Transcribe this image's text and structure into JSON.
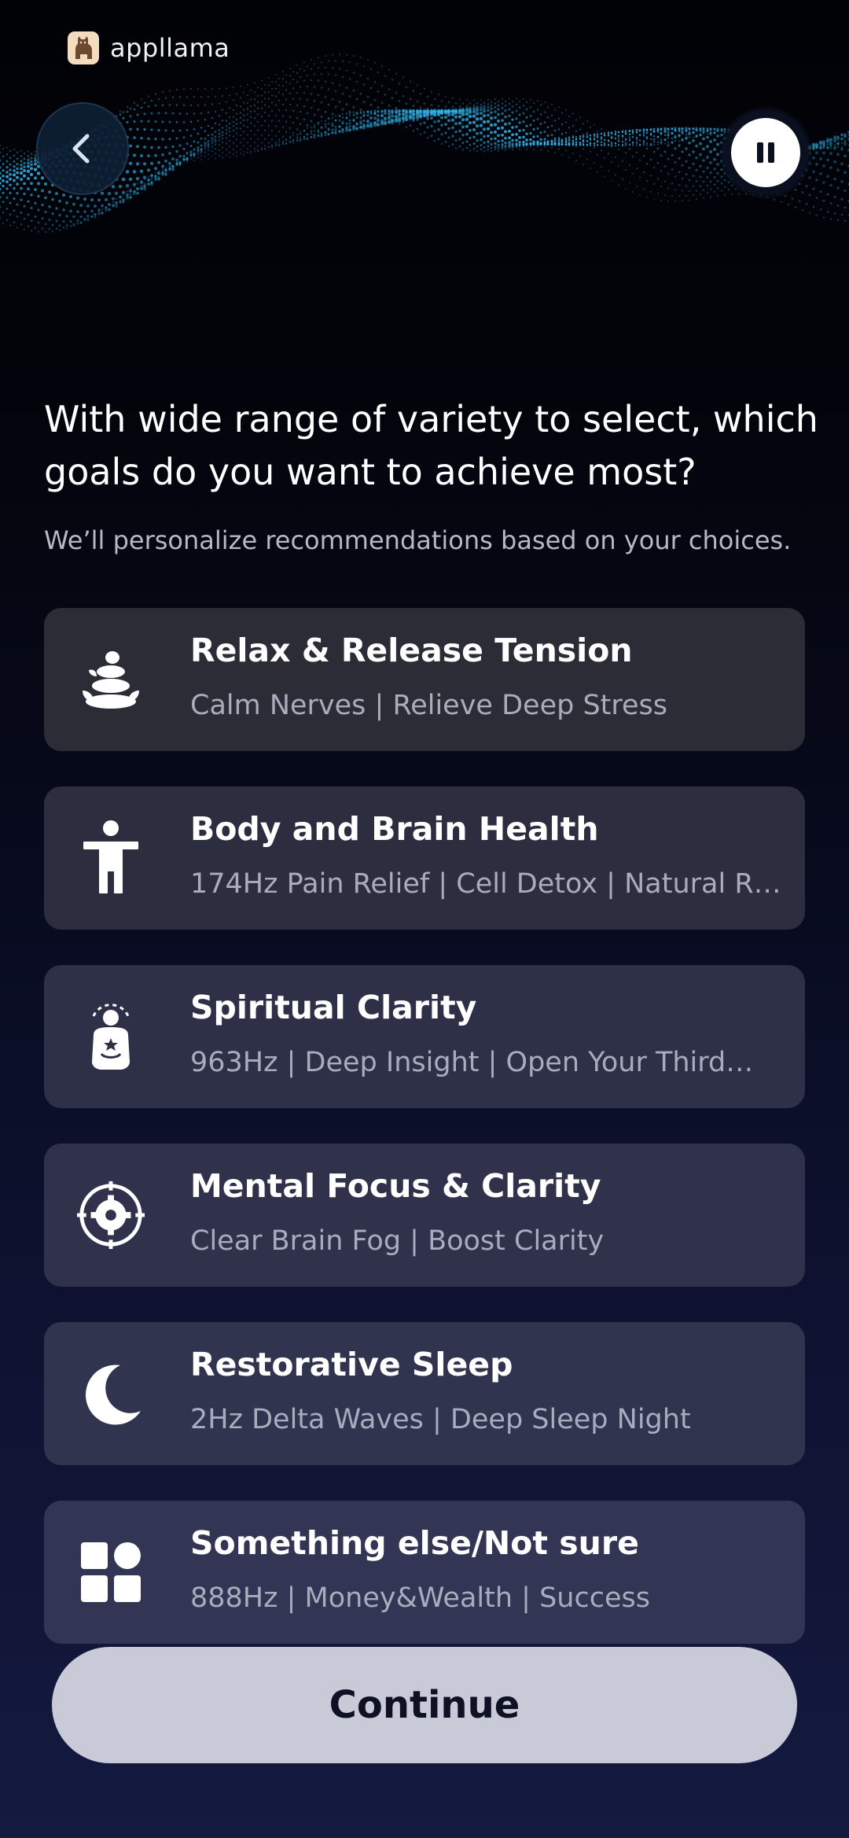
{
  "brand": {
    "name": "appllama",
    "logo_icon": "llama-icon"
  },
  "header": {
    "back_icon": "chevron-left-icon",
    "pause_icon": "pause-icon"
  },
  "question": {
    "title": "With wide range of variety to select, which goals do you want to achieve most?",
    "subtitle": "We’ll personalize recommendations based on your choices."
  },
  "options": [
    {
      "title": "Relax & Release Tension",
      "subtitle": "Calm Nerves | Relieve Deep Stress",
      "icon": "stacked-stones-icon",
      "bg": "#2c2c36"
    },
    {
      "title": "Body and Brain Health",
      "subtitle": "174Hz Pain Relief | Cell Detox | Natural R…",
      "icon": "person-body-icon",
      "bg": "#2c2e40"
    },
    {
      "title": "Spiritual Clarity",
      "subtitle": "963Hz | Deep Insight | Open Your Third…",
      "icon": "meditation-icon",
      "bg": "#2e3048"
    },
    {
      "title": "Mental Focus & Clarity",
      "subtitle": "Clear Brain Fog | Boost Clarity",
      "icon": "focus-target-icon",
      "bg": "#30324c"
    },
    {
      "title": "Restorative Sleep",
      "subtitle": "2Hz Delta Waves | Deep Sleep Night",
      "icon": "moon-icon",
      "bg": "#31344f"
    },
    {
      "title": "Something else/Not sure",
      "subtitle": "888Hz | Money&Wealth | Success",
      "icon": "category-grid-icon",
      "bg": "#323553"
    }
  ],
  "footer": {
    "continue_label": "Continue"
  },
  "colors": {
    "background_top": "#010206",
    "background_bottom": "#141a40",
    "wave_accent": "#2fb8f0",
    "button_bg": "#c9cad8",
    "button_text": "#0e1124"
  }
}
